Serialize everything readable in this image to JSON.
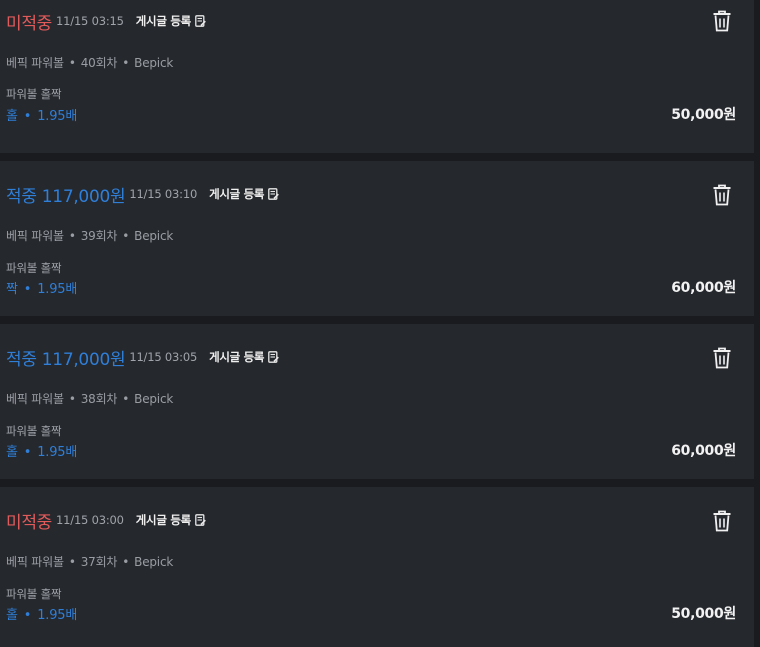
{
  "bets": [
    {
      "status": "미적중",
      "result": "lose",
      "time": "11/15 03:15",
      "post_label": "게시글 등록",
      "game": "베픽 파워볼",
      "round": "40회차",
      "site": "Bepick",
      "game_type": "파워볼 홀짝",
      "pick": "홀",
      "odds": "1.95배",
      "amount": "50,000원"
    },
    {
      "status": "적중 117,000원",
      "result": "win",
      "time": "11/15 03:10",
      "post_label": "게시글 등록",
      "game": "베픽 파워볼",
      "round": "39회차",
      "site": "Bepick",
      "game_type": "파워볼 홀짝",
      "pick": "짝",
      "odds": "1.95배",
      "amount": "60,000원"
    },
    {
      "status": "적중 117,000원",
      "result": "win",
      "time": "11/15 03:05",
      "post_label": "게시글 등록",
      "game": "베픽 파워볼",
      "round": "38회차",
      "site": "Bepick",
      "game_type": "파워볼 홀짝",
      "pick": "홀",
      "odds": "1.95배",
      "amount": "60,000원"
    },
    {
      "status": "미적중",
      "result": "lose",
      "time": "11/15 03:00",
      "post_label": "게시글 등록",
      "game": "베픽 파워볼",
      "round": "37회차",
      "site": "Bepick",
      "game_type": "파워볼 홀짝",
      "pick": "홀",
      "odds": "1.95배",
      "amount": "50,000원"
    }
  ],
  "separator": "•",
  "colors": {
    "win": "#2f7fd9",
    "lose": "#e25b5b",
    "card": "#25282d",
    "background": "#1a1b1e"
  },
  "icons": {
    "delete": "trash-icon",
    "post": "edit-note-icon"
  }
}
